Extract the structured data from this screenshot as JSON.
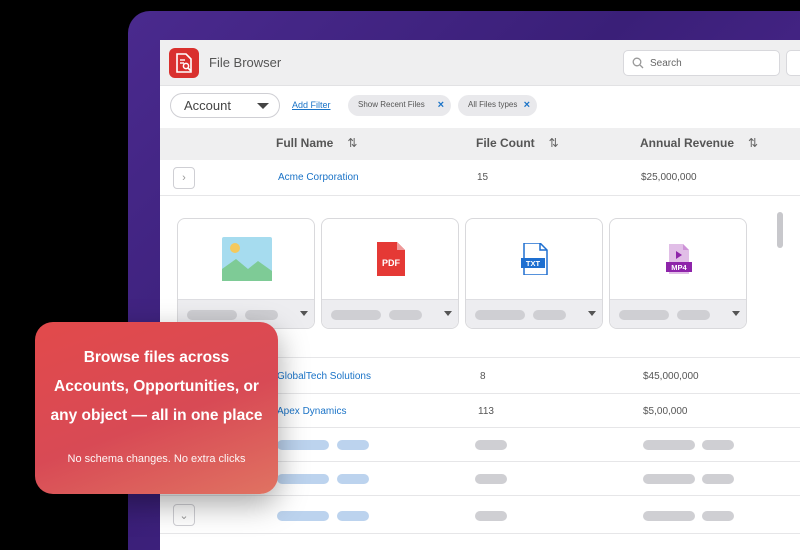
{
  "app": {
    "title": "File Browser",
    "search_placeholder": "Search"
  },
  "filters": {
    "object_select": "Account",
    "add_filter": "Add Filter",
    "chips": [
      {
        "label": "Show Recent Files",
        "remove": "×"
      },
      {
        "label": "All Files types",
        "remove": "×"
      }
    ]
  },
  "table": {
    "columns": [
      "Full Name",
      "File Count",
      "Annual Revenue"
    ],
    "sort_icon": "⇅",
    "rows": [
      {
        "name": "Acme Corporation",
        "count": "15",
        "revenue": "$25,000,000"
      },
      {
        "name": "GlobalTech Solutions",
        "count": "8",
        "revenue": "$45,000,000"
      },
      {
        "name": "Apex Dynamics",
        "count": "113",
        "revenue": "$5,00,000"
      }
    ]
  },
  "files": [
    {
      "type": "image",
      "icon": "image-file-icon"
    },
    {
      "type": "PDF",
      "icon": "pdf-file-icon"
    },
    {
      "type": "TXT",
      "icon": "txt-file-icon"
    },
    {
      "type": "MP4",
      "icon": "mp4-file-icon"
    }
  ],
  "callout": {
    "headline": "Browse files across Accounts, Opportunities, or any object — all in one place",
    "subtext": "No schema changes. No extra clicks"
  },
  "colors": {
    "accent": "#1a73c7",
    "brand_red": "#d9302e",
    "frame_purple": "#4a2a8e"
  }
}
